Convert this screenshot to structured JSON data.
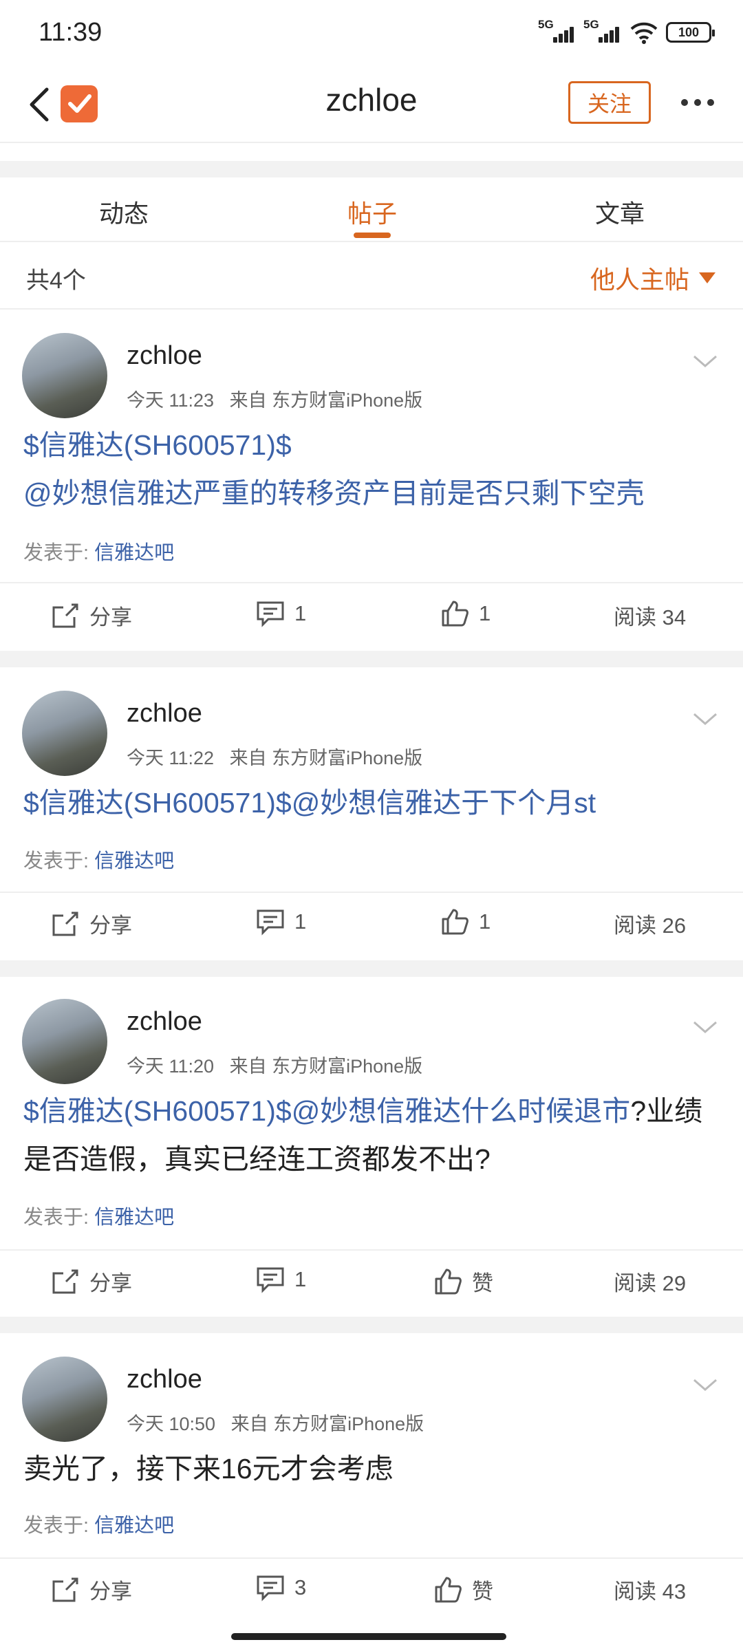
{
  "status_bar": {
    "time": "11:39",
    "sim1": "5G",
    "sim2": "5G",
    "battery": "100"
  },
  "header": {
    "title": "zchloe",
    "follow_label": "关注"
  },
  "tabs": [
    {
      "label": "动态"
    },
    {
      "label": "帖子"
    },
    {
      "label": "文章"
    }
  ],
  "list_header": {
    "count_text": "共4个",
    "filter_label": "他人主帖"
  },
  "posts": [
    {
      "author": "zchloe",
      "time": "今天 11:23",
      "source": "来自 东方财富iPhone版",
      "stock_tag": "$信雅达(SH600571)$",
      "mention": "@妙想信雅达严重的转移资产目前是否只剩下空壳",
      "plain": "",
      "posted_in_label": "发表于:",
      "forum": "信雅达吧",
      "share_label": "分享",
      "comments": "1",
      "likes": "1",
      "reads": "阅读 34"
    },
    {
      "author": "zchloe",
      "time": "今天 11:22",
      "source": "来自 东方财富iPhone版",
      "stock_tag": "$信雅达(SH600571)$",
      "mention": "@妙想信雅达于下个月st",
      "plain": "",
      "posted_in_label": "发表于:",
      "forum": "信雅达吧",
      "share_label": "分享",
      "comments": "1",
      "likes": "1",
      "reads": "阅读 26"
    },
    {
      "author": "zchloe",
      "time": "今天 11:20",
      "source": "来自 东方财富iPhone版",
      "stock_tag": "$信雅达(SH600571)$",
      "mention": "@妙想信雅达什么时候退市",
      "plain": "?业绩是否造假，真实已经连工资都发不出?",
      "posted_in_label": "发表于:",
      "forum": "信雅达吧",
      "share_label": "分享",
      "comments": "1",
      "likes": "赞",
      "reads": "阅读 29"
    },
    {
      "author": "zchloe",
      "time": "今天 10:50",
      "source": "来自 东方财富iPhone版",
      "stock_tag": "",
      "mention": "",
      "plain": "卖光了，接下来16元才会考虑",
      "posted_in_label": "发表于:",
      "forum": "信雅达吧",
      "share_label": "分享",
      "comments": "3",
      "likes": "赞",
      "reads": "阅读 43"
    }
  ],
  "colors": {
    "accent": "#d8661f",
    "link": "#3c62a8",
    "logo": "#ee6a37"
  },
  "icons": [
    "back-arrow-icon",
    "app-logo-icon",
    "more-icon",
    "chevron-down-icon",
    "share-icon",
    "comment-icon",
    "like-icon"
  ]
}
